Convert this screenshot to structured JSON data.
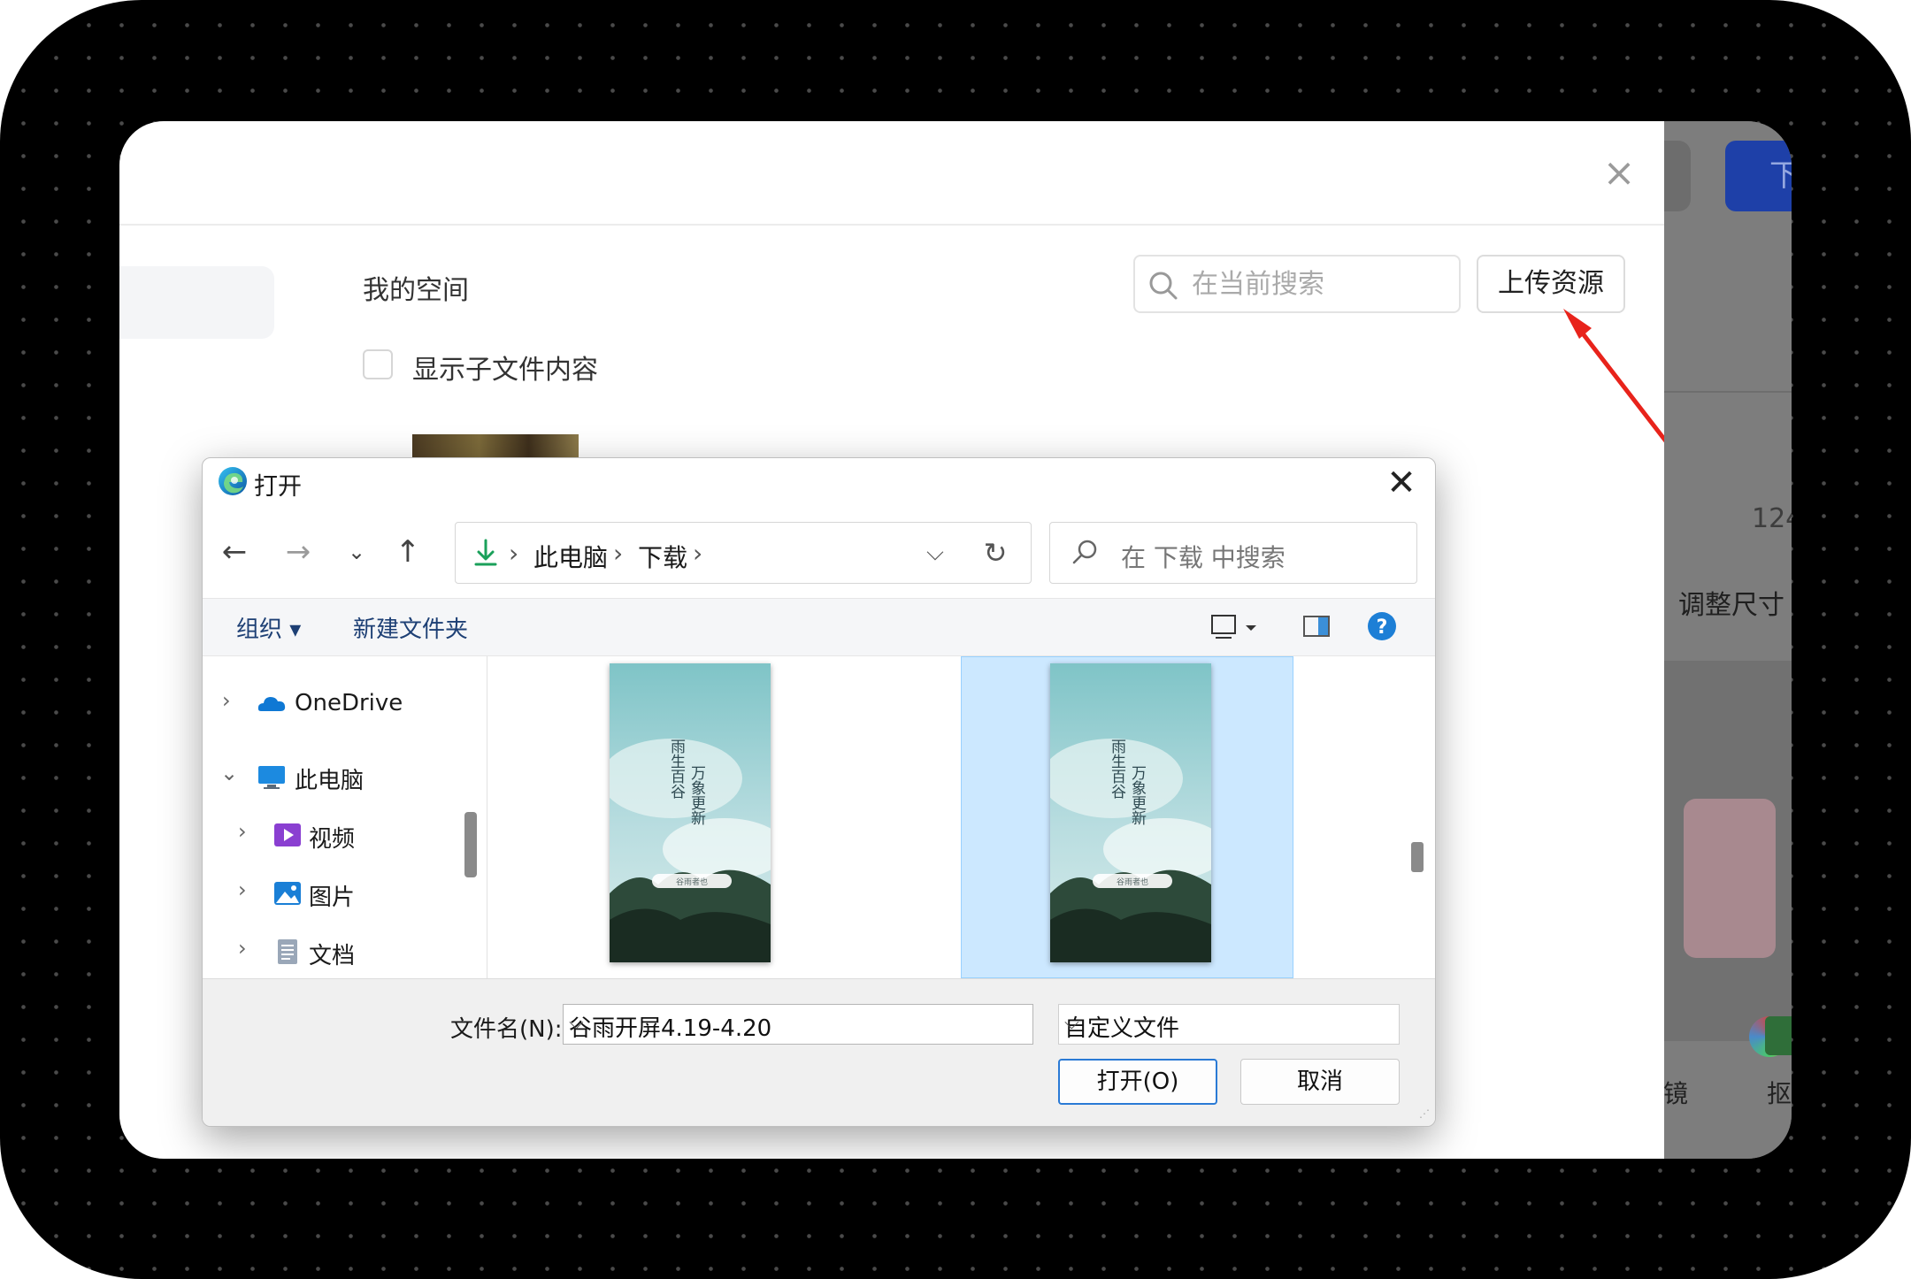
{
  "modal": {
    "close_label": "×",
    "breadcrumb": "我的空间",
    "search_placeholder": "在当前搜索",
    "upload_button": "上传资源",
    "show_subfolder_label": "显示子文件内容"
  },
  "background_app": {
    "top_button_partial": "下",
    "number_partial": "124",
    "resize_label": "调整尺寸",
    "tool_label_1_partial": "镜",
    "tool_label_2_partial": "抠"
  },
  "dialog": {
    "title": "打开",
    "close_label": "✕",
    "nav": {
      "back": "←",
      "forward": "→",
      "recent": "⌄",
      "up": "↑"
    },
    "address": {
      "segments": [
        "此电脑",
        "下载"
      ],
      "separator": "›",
      "dropdown": "⌵",
      "refresh": "↻"
    },
    "search_placeholder": "在 下载 中搜索",
    "toolbar": {
      "organize": "组织 ▾",
      "new_folder": "新建文件夹"
    },
    "nav_pane": {
      "items": [
        {
          "label": "OneDrive",
          "chevron": "›",
          "icon": "onedrive-cloud-icon"
        },
        {
          "label": "此电脑",
          "chevron": "⌄",
          "icon": "this-pc-monitor-icon"
        },
        {
          "label": "视频",
          "chevron": "›",
          "icon": "videos-folder-icon"
        },
        {
          "label": "图片",
          "chevron": "›",
          "icon": "pictures-folder-icon"
        },
        {
          "label": "文档",
          "chevron": "›",
          "icon": "documents-folder-icon"
        }
      ]
    },
    "files": [
      {
        "title_left": "雨生百谷",
        "title_right": "万象更新",
        "badge": "谷雨者也",
        "selected": false
      },
      {
        "title_left": "雨生百谷",
        "title_right": "万象更新",
        "badge": "谷雨者也",
        "selected": true
      }
    ],
    "filename_label": "文件名(N):",
    "filename_value": "谷雨开屏4.19-4.20",
    "filetype_value": "自定义文件",
    "open_button": "打开(O)",
    "cancel_button": "取消"
  },
  "colors": {
    "accent_blue": "#2a7ad5",
    "selection": "#cce8ff",
    "annotation_red": "#e8231b"
  }
}
